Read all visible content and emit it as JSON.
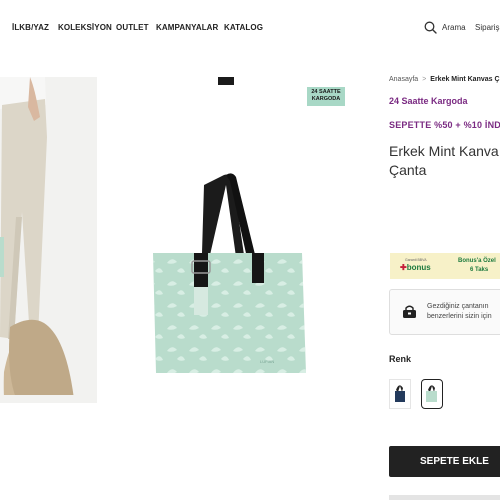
{
  "nav": {
    "items": [
      "İLKB/YAZ",
      "KOLEKSİYON",
      "OUTLET",
      "KAMPANYALAR",
      "KATALOG"
    ],
    "search_label": "Arama",
    "orders_label": "Siparişl"
  },
  "gallery": {
    "badge_line1": "24 SAATTE",
    "badge_line2": "KARGODA",
    "bag_logo_text": "LUFIAN"
  },
  "breadcrumb": {
    "home": "Anasayfa",
    "separator": ">",
    "current": "Erkek Mint Kanvas Ç"
  },
  "product": {
    "shipping_note": "24 Saatte Kargoda",
    "discount_note": "SEPETTE %50 + %10 İND",
    "title_line1": "Erkek Mint Kanva",
    "title_line2": "Çanta"
  },
  "promo": {
    "bonus_small": "Garanti BBVA",
    "bonus_logo": "bonus",
    "text_line1": "Bonus'a Özel",
    "text_line2": "6 Taks"
  },
  "info": {
    "line1": "Gezdiğiniz çantanın",
    "line2": "benzerlerini sizin için"
  },
  "color_section": {
    "label": "Renk"
  },
  "actions": {
    "add_to_cart": "SEPETE EKLE"
  },
  "colors": {
    "accent_purple": "#7a2a82",
    "mint": "#b9dccc",
    "button_dark": "#222222",
    "promo_bg": "#f7f1c8"
  }
}
